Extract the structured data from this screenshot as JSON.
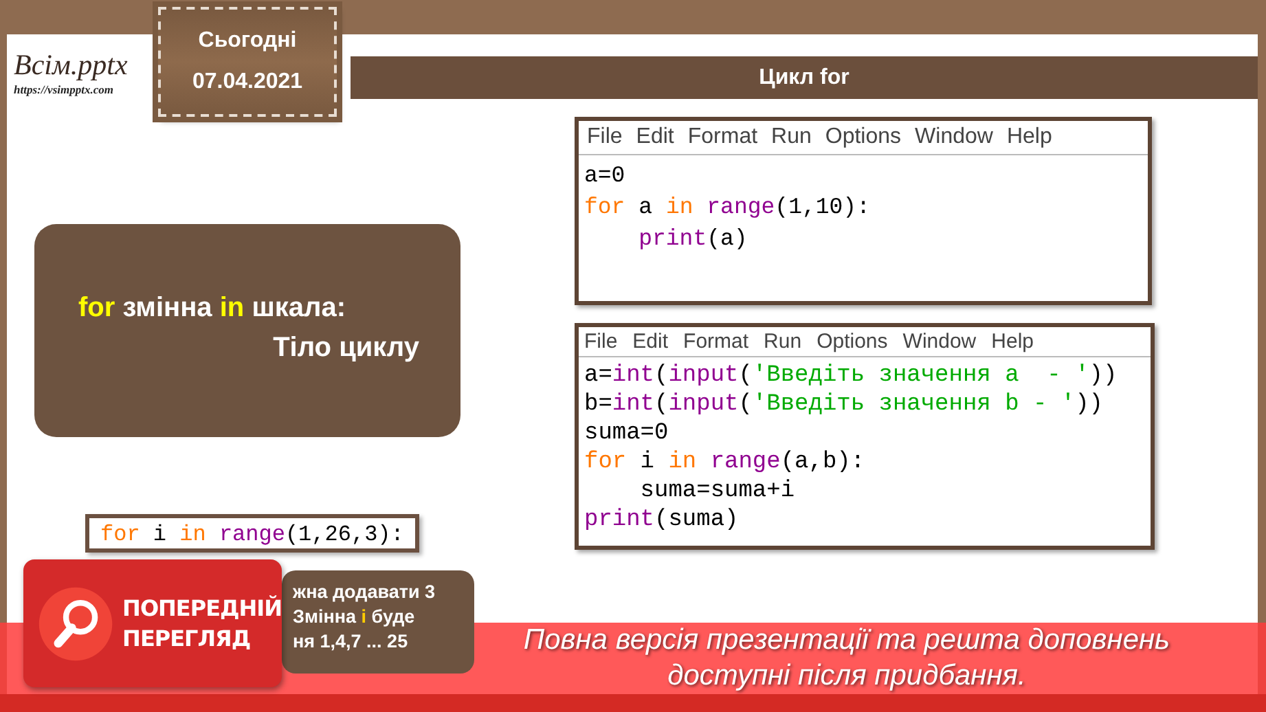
{
  "logo": {
    "name": "Всім.pptx",
    "url": "https://vsimpptx.com"
  },
  "date_tag": {
    "label": "Сьогодні",
    "date": "07.04.2021"
  },
  "title": "Цикл for",
  "syntax_box": {
    "lines": [
      [
        {
          "text": "for",
          "highlight": true
        },
        {
          "text": " змінна ",
          "highlight": false
        },
        {
          "text": "in",
          "highlight": true
        },
        {
          "text": " шкала:",
          "highlight": false
        }
      ],
      [
        {
          "text": "Тіло циклу",
          "highlight": false
        }
      ]
    ]
  },
  "example_code": [
    [
      {
        "kind": "keyword",
        "text": "for"
      },
      {
        "kind": "plain",
        "text": " i "
      },
      {
        "kind": "keyword",
        "text": "in "
      },
      {
        "kind": "builtin",
        "text": "range"
      },
      {
        "kind": "plain",
        "text": "(1,26,3):"
      }
    ]
  ],
  "note_box": {
    "lines": [
      [
        {
          "text": "жна додавати 3",
          "highlight": false
        }
      ],
      [
        {
          "text": "Змінна ",
          "highlight": false
        },
        {
          "text": "і",
          "highlight": true
        },
        {
          "text": " буде",
          "highlight": false
        }
      ],
      [
        {
          "text": "ня 1,4,7 ... 25",
          "highlight": false
        }
      ]
    ]
  },
  "editors": [
    {
      "menu": [
        "File",
        "Edit",
        "Format",
        "Run",
        "Options",
        "Window",
        "Help"
      ],
      "code": [
        [
          {
            "kind": "plain",
            "text": "a=0"
          }
        ],
        [
          {
            "kind": "keyword",
            "text": "for"
          },
          {
            "kind": "plain",
            "text": " a "
          },
          {
            "kind": "keyword",
            "text": "in "
          },
          {
            "kind": "builtin",
            "text": "range"
          },
          {
            "kind": "plain",
            "text": "(1,10):"
          }
        ],
        [
          {
            "kind": "builtin",
            "text": "    print"
          },
          {
            "kind": "plain",
            "text": "(a)"
          }
        ]
      ]
    },
    {
      "menu": [
        "File",
        "Edit",
        "Format",
        "Run",
        "Options",
        "Window",
        "Help"
      ],
      "code": [
        [
          {
            "kind": "plain",
            "text": "a="
          },
          {
            "kind": "builtin",
            "text": "int"
          },
          {
            "kind": "plain",
            "text": "("
          },
          {
            "kind": "builtin",
            "text": "input"
          },
          {
            "kind": "plain",
            "text": "("
          },
          {
            "kind": "string",
            "text": "'Введіть значення a  - '"
          },
          {
            "kind": "plain",
            "text": "))"
          }
        ],
        [
          {
            "kind": "plain",
            "text": "b="
          },
          {
            "kind": "builtin",
            "text": "int"
          },
          {
            "kind": "plain",
            "text": "("
          },
          {
            "kind": "builtin",
            "text": "input"
          },
          {
            "kind": "plain",
            "text": "("
          },
          {
            "kind": "string",
            "text": "'Введіть значення b - '"
          },
          {
            "kind": "plain",
            "text": "))"
          }
        ],
        [
          {
            "kind": "plain",
            "text": "suma=0"
          }
        ],
        [
          {
            "kind": "keyword",
            "text": "for"
          },
          {
            "kind": "plain",
            "text": " i "
          },
          {
            "kind": "keyword",
            "text": "in "
          },
          {
            "kind": "builtin",
            "text": "range"
          },
          {
            "kind": "plain",
            "text": "(a,b):"
          }
        ],
        [
          {
            "kind": "plain",
            "text": "    suma=suma+i"
          }
        ],
        [
          {
            "kind": "builtin",
            "text": "print"
          },
          {
            "kind": "plain",
            "text": "(suma)"
          }
        ]
      ]
    }
  ],
  "preview_banner": {
    "badge": [
      "ПОПЕРЕДНІЙ",
      "ПЕРЕГЛЯД"
    ],
    "message": [
      "Повна версія презентації та решта доповнень",
      "доступні після придбання."
    ]
  }
}
